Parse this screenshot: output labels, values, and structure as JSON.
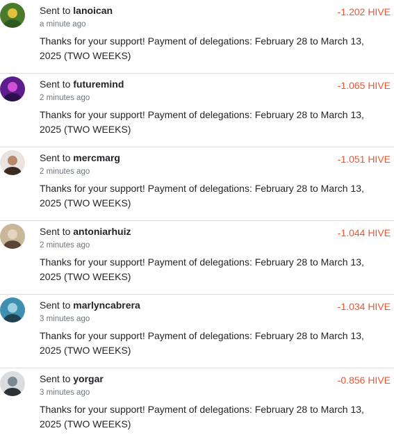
{
  "transfers": [
    {
      "sent_prefix": "Sent to",
      "recipient": "lanoican",
      "time_ago": "a minute ago",
      "amount": "-1.202 HIVE",
      "memo": "Thanks for your support! Payment of delegations: February 28 to March 13, 2025 (TWO WEEKS)",
      "avatar_colors": [
        "#4a7a2c",
        "#e0c23a",
        "#2f5a1e"
      ]
    },
    {
      "sent_prefix": "Sent to",
      "recipient": "futuremind",
      "time_ago": "2 minutes ago",
      "amount": "-1.065 HIVE",
      "memo": "Thanks for your support! Payment of delegations: February 28 to March 13, 2025 (TWO WEEKS)",
      "avatar_colors": [
        "#5b1e8c",
        "#d24fd6",
        "#2a0f4a"
      ]
    },
    {
      "sent_prefix": "Sent to",
      "recipient": "mercmarg",
      "time_ago": "2 minutes ago",
      "amount": "-1.051 HIVE",
      "memo": "Thanks for your support! Payment of delegations: February 28 to March 13, 2025 (TWO WEEKS)",
      "avatar_colors": [
        "#e9e4df",
        "#b48a6a",
        "#3a2a22"
      ]
    },
    {
      "sent_prefix": "Sent to",
      "recipient": "antoniarhuiz",
      "time_ago": "2 minutes ago",
      "amount": "-1.044 HIVE",
      "memo": "Thanks for your support! Payment of delegations: February 28 to March 13, 2025 (TWO WEEKS)",
      "avatar_colors": [
        "#c9b79a",
        "#e6d3c0",
        "#5a4636"
      ]
    },
    {
      "sent_prefix": "Sent to",
      "recipient": "marlyncabrera",
      "time_ago": "3 minutes ago",
      "amount": "-1.034 HIVE",
      "memo": "Thanks for your support! Payment of delegations: February 28 to March 13, 2025 (TWO WEEKS)",
      "avatar_colors": [
        "#3f8fb0",
        "#9fd0e0",
        "#20424f"
      ]
    },
    {
      "sent_prefix": "Sent to",
      "recipient": "yorgar",
      "time_ago": "3 minutes ago",
      "amount": "-0.856 HIVE",
      "memo": "Thanks for your support! Payment of delegations: February 28 to March 13, 2025 (TWO WEEKS)",
      "avatar_colors": [
        "#d9dde0",
        "#7a8a90",
        "#2c3236"
      ]
    }
  ]
}
